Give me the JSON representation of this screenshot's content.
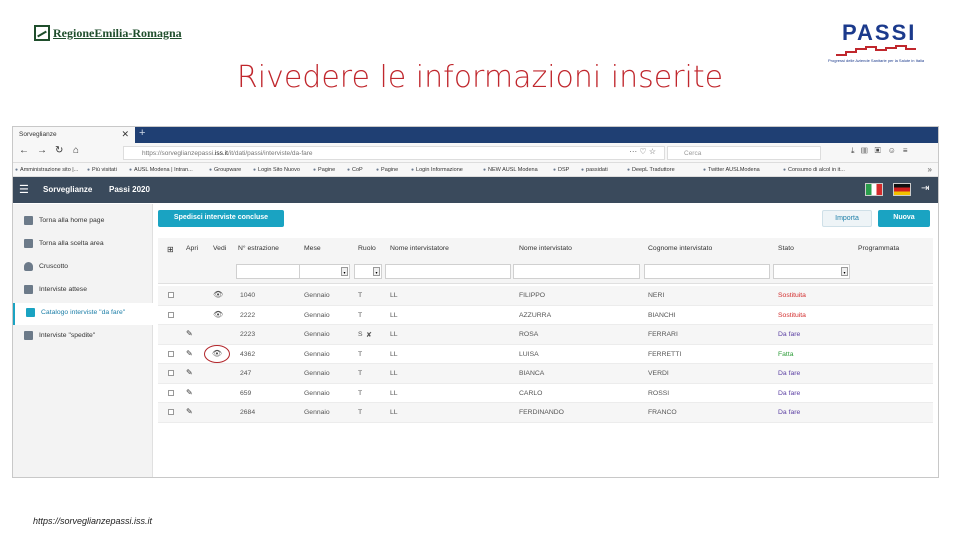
{
  "slide": {
    "title": "Rivedere le informazioni inserite",
    "logo_left": "RegioneEmilia-Romagna",
    "logo_right": "PASSI",
    "logo_right_tagline": "Progressi delle Aziende Sanitarie per la Salute in Italia",
    "footer_url": "https://sorveglianzepassi.iss.it"
  },
  "browser": {
    "tab_title": "Sorveglianze",
    "url_prefix": "https://sorveglianzepassi.",
    "url_host": "iss.it",
    "url_path": "/it/dati/passi/interviste/da-fare",
    "search_placeholder": "Cerca",
    "bookmarks": [
      "Amministrazione sito |...",
      "Più visitati",
      "AUSL Modena | Intran...",
      "Groupware",
      "Login Sito Nuovo",
      "Pagine",
      "CoP",
      "Pagine",
      "Login Informazione",
      "NEW AUSL Modena",
      "DSP",
      "passidati",
      "DeepL Traduttore",
      "Twitter AUSLModena",
      "Consumo di alcol in it..."
    ]
  },
  "app": {
    "name": "Sorveglianze",
    "survey": "Passi 2020",
    "flags": [
      "it",
      "de"
    ]
  },
  "sidebar": {
    "items": [
      {
        "label": "Torna alla home page",
        "icon": "home-icon",
        "color": "#6c7a89"
      },
      {
        "label": "Torna alla scelta area",
        "icon": "list-icon",
        "color": "#6c7a89"
      },
      {
        "label": "Cruscotto",
        "icon": "dashboard-icon",
        "color": "#6c7a89"
      },
      {
        "label": "Interviste attese",
        "icon": "checklist-icon",
        "color": "#6c7a89"
      },
      {
        "label": "Catalogo interviste \"da fare\"",
        "icon": "clipboard-icon",
        "color": "#1aa3c2"
      },
      {
        "label": "Interviste \"spedite\"",
        "icon": "clipboard-check-icon",
        "color": "#6c7a89"
      }
    ]
  },
  "toolbar": {
    "send_label": "Spedisci interviste concluse",
    "import_label": "Importa",
    "new_label": "Nuova"
  },
  "table": {
    "headers": [
      "Apri",
      "Vedi",
      "N° estrazione",
      "Mese",
      "Ruolo",
      "Nome intervistatore",
      "Nome intervistato",
      "Cognome intervistato",
      "Stato",
      "Programmata"
    ],
    "rows": [
      {
        "action": "view",
        "n": "1040",
        "mese": "Gennaio",
        "ruolo": "T",
        "intervistatore": "LL",
        "nome": "FILIPPO",
        "cognome": "NERI",
        "stato": "Sostituita",
        "stato_color": "#d32f2f"
      },
      {
        "action": "view",
        "n": "2222",
        "mese": "Gennaio",
        "ruolo": "T",
        "intervistatore": "LL",
        "nome": "AZZURRA",
        "cognome": "BIANCHI",
        "stato": "Sostituita",
        "stato_color": "#d32f2f"
      },
      {
        "action": "edit",
        "n": "2223",
        "mese": "Gennaio",
        "ruolo": "S",
        "intervistatore": "LL",
        "nome": "ROSA",
        "cognome": "FERRARI",
        "stato": "Da fare",
        "stato_color": "#5b3fa3"
      },
      {
        "action": "edit-view",
        "n": "4362",
        "mese": "Gennaio",
        "ruolo": "T",
        "intervistatore": "LL",
        "nome": "LUISA",
        "cognome": "FERRETTI",
        "stato": "Fatta",
        "stato_color": "#2e9d3a"
      },
      {
        "action": "edit",
        "n": "247",
        "mese": "Gennaio",
        "ruolo": "T",
        "intervistatore": "LL",
        "nome": "BIANCA",
        "cognome": "VERDI",
        "stato": "Da fare",
        "stato_color": "#5b3fa3"
      },
      {
        "action": "edit",
        "n": "659",
        "mese": "Gennaio",
        "ruolo": "T",
        "intervistatore": "LL",
        "nome": "CARLO",
        "cognome": "ROSSI",
        "stato": "Da fare",
        "stato_color": "#5b3fa3"
      },
      {
        "action": "edit",
        "n": "2684",
        "mese": "Gennaio",
        "ruolo": "T",
        "intervistatore": "LL",
        "nome": "FERDINANDO",
        "cognome": "FRANCO",
        "stato": "Da fare",
        "stato_color": "#5b3fa3"
      }
    ]
  }
}
